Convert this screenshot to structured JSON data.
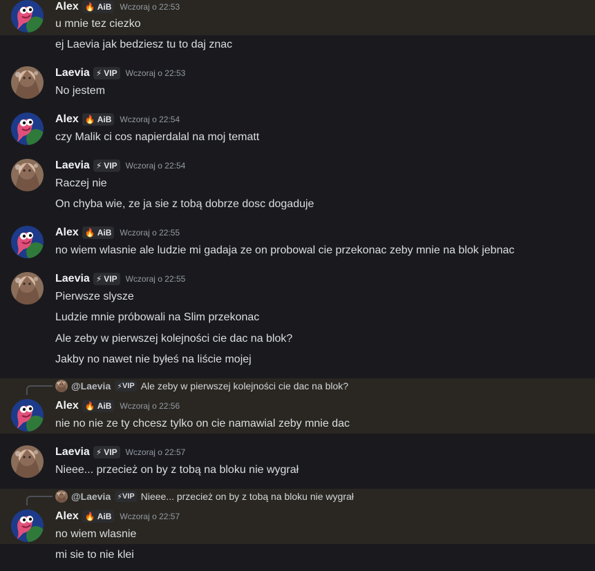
{
  "users": {
    "alex": {
      "name": "Alex",
      "tag": "AiB",
      "tag_icon": "flame-icon"
    },
    "laevia": {
      "name": "Laevia",
      "tag": "VIP",
      "tag_icon": "lightning-icon"
    }
  },
  "messages": [
    {
      "author": "Alex",
      "tag": "AiB",
      "time": "Wczoraj o 22:53",
      "lines": [
        "u mnie tez ciezko",
        "ej Laevia jak bedziesz tu to daj znac"
      ]
    },
    {
      "author": "Laevia",
      "tag": "VIP",
      "time": "Wczoraj o 22:53",
      "lines": [
        "No jestem"
      ]
    },
    {
      "author": "Alex",
      "tag": "AiB",
      "time": "Wczoraj o 22:54",
      "lines": [
        "czy Malik ci cos napierdalal na moj tematt"
      ]
    },
    {
      "author": "Laevia",
      "tag": "VIP",
      "time": "Wczoraj o 22:54",
      "lines": [
        "Raczej nie",
        "On chyba wie, ze ja sie z tobą dobrze dosc dogaduje"
      ]
    },
    {
      "author": "Alex",
      "tag": "AiB",
      "time": "Wczoraj o 22:55",
      "lines": [
        "no wiem wlasnie ale ludzie mi gadaja ze on probowal cie przekonac zeby mnie na blok jebnac"
      ]
    },
    {
      "author": "Laevia",
      "tag": "VIP",
      "time": "Wczoraj o 22:55",
      "lines": [
        "Pierwsze slysze",
        "Ludzie mnie próbowali na Slim przekonac",
        "Ale zeby w pierwszej kolejności cie dac na blok?",
        "Jakby no nawet nie byłeś na liście mojej"
      ]
    },
    {
      "author": "Alex",
      "tag": "AiB",
      "time": "Wczoraj o 22:56",
      "reply": {
        "name": "@Laevia",
        "tag": "VIP",
        "text": "Ale zeby w pierwszej kolejności cie dac na blok?"
      },
      "lines": [
        "nie no nie ze ty chcesz tylko on cie namawial zeby mnie dac"
      ]
    },
    {
      "author": "Laevia",
      "tag": "VIP",
      "time": "Wczoraj o 22:57",
      "lines": [
        "Nieee... przecież on by z tobą na bloku nie wygrał"
      ]
    },
    {
      "author": "Alex",
      "tag": "AiB",
      "time": "Wczoraj o 22:57",
      "reply": {
        "name": "@Laevia",
        "tag": "VIP",
        "text": "Nieee... przecież on by z tobą na bloku nie wygrał"
      },
      "lines": [
        "no wiem wlasnie",
        "mi sie to nie klei"
      ]
    }
  ],
  "colors": {
    "background": "#1a1a1e",
    "highlight": "#2a2722",
    "username": "#f2f3f5",
    "timestamp": "#949ba4",
    "tag_bg": "#2c2d31"
  }
}
